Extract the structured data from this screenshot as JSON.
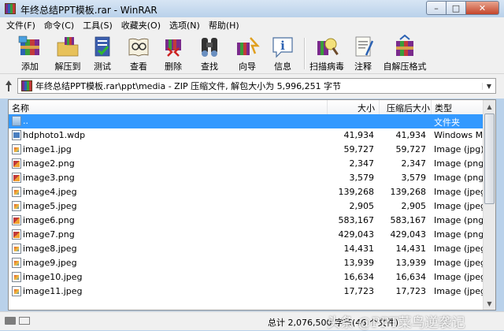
{
  "window": {
    "title": "年终总结PPT模板.rar - WinRAR"
  },
  "menu": [
    "文件(F)",
    "命令(C)",
    "工具(S)",
    "收藏夹(O)",
    "选项(N)",
    "帮助(H)"
  ],
  "toolbar": [
    {
      "label": "添加",
      "icon": "add-archive-icon"
    },
    {
      "label": "解压到",
      "icon": "extract-to-icon"
    },
    {
      "label": "测试",
      "icon": "test-icon"
    },
    {
      "label": "查看",
      "icon": "view-icon"
    },
    {
      "label": "删除",
      "icon": "delete-icon"
    },
    {
      "label": "查找",
      "icon": "find-icon"
    },
    {
      "label": "向导",
      "icon": "wizard-icon"
    },
    {
      "label": "信息",
      "icon": "info-icon"
    },
    {
      "label": "扫描病毒",
      "icon": "virus-scan-icon"
    },
    {
      "label": "注释",
      "icon": "comment-icon"
    },
    {
      "label": "自解压格式",
      "icon": "sfx-icon"
    }
  ],
  "address": {
    "text": "年终总结PPT模板.rar\\ppt\\media - ZIP 压缩文件, 解包大小为 5,996,251 字节"
  },
  "columns": {
    "name": "名称",
    "size": "大小",
    "packed": "压缩后大小",
    "type": "类型"
  },
  "files": [
    {
      "name": "..",
      "size": "",
      "packed": "",
      "type": "文件夹",
      "icon": "folder"
    },
    {
      "name": "hdphoto1.wdp",
      "size": "41,934",
      "packed": "41,934",
      "type": "Windows Med",
      "icon": "wdp"
    },
    {
      "name": "image1.jpg",
      "size": "59,727",
      "packed": "59,727",
      "type": "Image (jpg) F",
      "icon": "img"
    },
    {
      "name": "image2.png",
      "size": "2,347",
      "packed": "2,347",
      "type": "Image (png) I",
      "icon": "png"
    },
    {
      "name": "image3.png",
      "size": "3,579",
      "packed": "3,579",
      "type": "Image (png) I",
      "icon": "png"
    },
    {
      "name": "image4.jpeg",
      "size": "139,268",
      "packed": "139,268",
      "type": "Image (jpeg)",
      "icon": "img"
    },
    {
      "name": "image5.jpeg",
      "size": "2,905",
      "packed": "2,905",
      "type": "Image (jpeg)",
      "icon": "img"
    },
    {
      "name": "image6.png",
      "size": "583,167",
      "packed": "583,167",
      "type": "Image (png) I",
      "icon": "png"
    },
    {
      "name": "image7.png",
      "size": "429,043",
      "packed": "429,043",
      "type": "Image (png) I",
      "icon": "png"
    },
    {
      "name": "image8.jpeg",
      "size": "14,431",
      "packed": "14,431",
      "type": "Image (jpeg)",
      "icon": "img"
    },
    {
      "name": "image9.jpeg",
      "size": "13,939",
      "packed": "13,939",
      "type": "Image (jpeg)",
      "icon": "img"
    },
    {
      "name": "image10.jpeg",
      "size": "16,634",
      "packed": "16,634",
      "type": "Image (jpeg)",
      "icon": "img"
    },
    {
      "name": "image11.jpeg",
      "size": "17,723",
      "packed": "17,723",
      "type": "Image (jpeg)",
      "icon": "img"
    }
  ],
  "status": {
    "text": "总计 2,076,500 字节(46 个文件)"
  },
  "watermark": "头条 @PPT菜鸟逆袭记",
  "colors": {
    "selection": "#3399ff",
    "titlebar": "#b9d1ea"
  }
}
